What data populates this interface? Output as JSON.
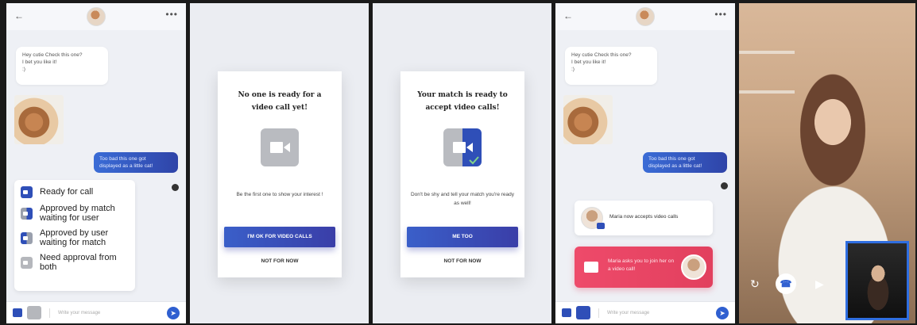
{
  "colors": {
    "accent": "#2f4fb8",
    "pink": "#e94563",
    "grey": "#b5b7bc",
    "bg": "#eef0f5"
  },
  "chat": {
    "incoming_text": "Hey cutie Check this one?\nI bet you like it!\n:)",
    "outgoing_text": "Too bad this one got\ndisplayed as a little cat!",
    "input_placeholder": "Write your message"
  },
  "legend": [
    {
      "label": "Ready for call",
      "icon": "video-ready-icon"
    },
    {
      "label": "Approved by match waiting for user",
      "icon": "video-approved-match-icon"
    },
    {
      "label": "Approved by user waiting for match",
      "icon": "video-approved-user-icon"
    },
    {
      "label": "Need approval from both",
      "icon": "video-need-approval-icon"
    }
  ],
  "dialog_not_ready": {
    "title": "No one is ready for a video call yet!",
    "subtitle": "Be the first one to show your interest !",
    "cta": "I'M OK FOR VIDEO CALLS",
    "secondary": "NOT FOR NOW"
  },
  "dialog_ready": {
    "title": "Your match is ready to accept video calls!",
    "subtitle": "Don't be shy and tell your match you're ready as well!",
    "cta": "ME TOO",
    "secondary": "NOT FOR NOW"
  },
  "notifications": {
    "accepts": "Maria now accepts video calls",
    "invite": "Maria asks you to join her on a video call!"
  },
  "video_call": {
    "controls": [
      "switch-camera-icon",
      "hang-up-icon",
      "video-off-icon"
    ]
  }
}
